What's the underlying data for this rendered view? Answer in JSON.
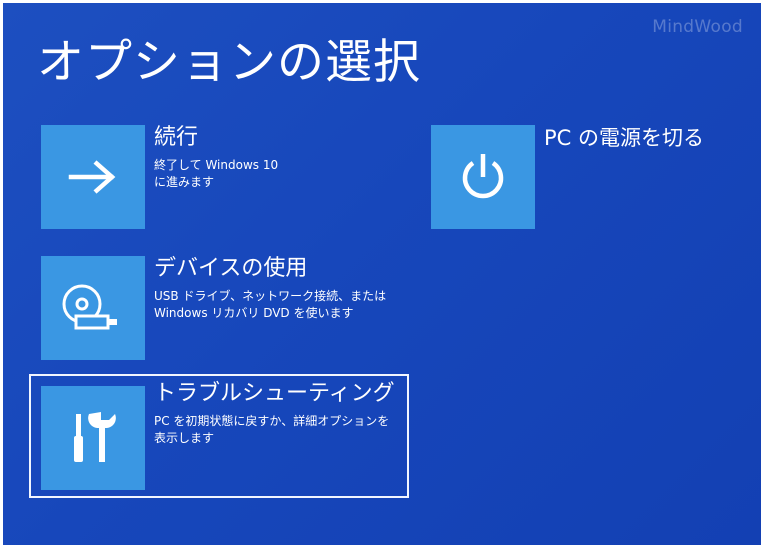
{
  "watermark": "MindWood",
  "title": "オプションの選択",
  "options": {
    "continue": {
      "title": "続行",
      "description": "終了して Windows 10\nに進みます",
      "icon": "arrow-right-icon"
    },
    "use_device": {
      "title": "デバイスの使用",
      "description": "USB ドライブ、ネットワーク接続、または\nWindows リカバリ DVD を使います",
      "icon": "disc-usb-icon"
    },
    "troubleshoot": {
      "title": "トラブルシューティング",
      "description": "PC を初期状態に戻すか、詳細オプションを\n表示します",
      "icon": "tools-icon",
      "selected": true
    },
    "power_off": {
      "title": "PC の電源を切る",
      "icon": "power-icon"
    }
  },
  "colors": {
    "background": "#1747bb",
    "tile": "#3a97e3",
    "text": "#ffffff"
  }
}
